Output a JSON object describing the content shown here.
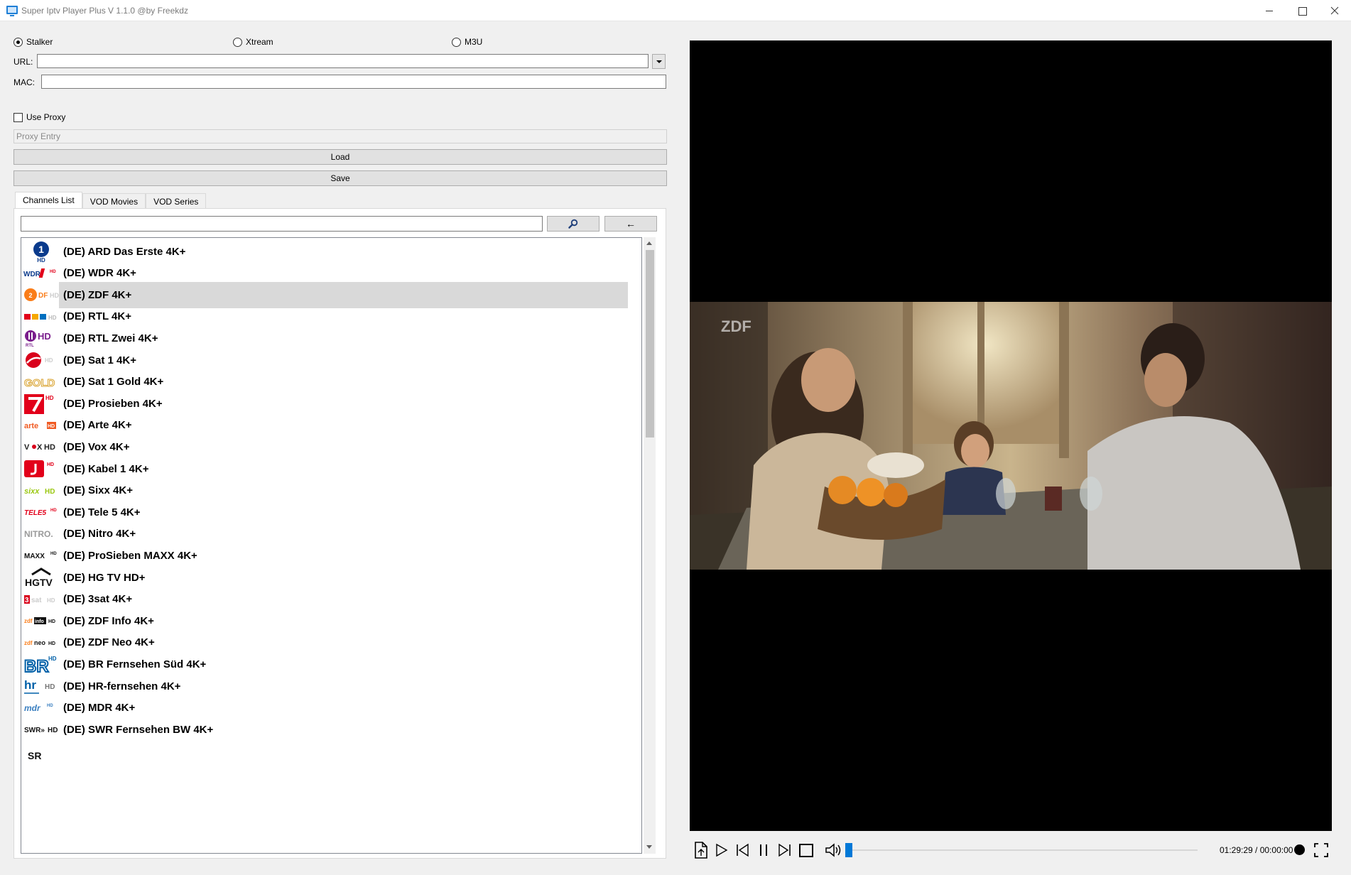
{
  "window": {
    "title": "Super Iptv Player Plus V 1.1.0 @by Freekdz"
  },
  "source_type": {
    "options": [
      "Stalker",
      "Xtream",
      "M3U"
    ],
    "selected": "Stalker"
  },
  "form": {
    "url_label": "URL:",
    "url_value": "",
    "mac_label": "MAC:",
    "mac_value": "",
    "use_proxy_label": "Use Proxy",
    "use_proxy_checked": false,
    "proxy_placeholder": "Proxy Entry",
    "load_label": "Load",
    "save_label": "Save"
  },
  "tabs": [
    {
      "label": "Channels List",
      "active": true
    },
    {
      "label": "VOD Movies",
      "active": false
    },
    {
      "label": "VOD Series",
      "active": false
    }
  ],
  "search": {
    "value": "",
    "search_icon": "magnifier-icon",
    "back_label": "←"
  },
  "channels": [
    {
      "name": "(DE) ARD Das Erste 4K+",
      "logo": "ARD 1 HD",
      "selected": false
    },
    {
      "name": "(DE) WDR 4K+",
      "logo": "WDR HD",
      "selected": false
    },
    {
      "name": "(DE) ZDF 4K+",
      "logo": "ZDF HD",
      "selected": true
    },
    {
      "name": "(DE) RTL 4K+",
      "logo": "RTL HD",
      "selected": false
    },
    {
      "name": "(DE) RTL Zwei 4K+",
      "logo": "RTL II HD",
      "selected": false
    },
    {
      "name": "(DE) Sat 1 4K+",
      "logo": "Sat.1 HD",
      "selected": false
    },
    {
      "name": "(DE) Sat 1 Gold 4K+",
      "logo": "GOLD",
      "selected": false
    },
    {
      "name": "(DE) Prosieben 4K+",
      "logo": "ProSieben HD",
      "selected": false
    },
    {
      "name": "(DE) Arte 4K+",
      "logo": "arte HD",
      "selected": false
    },
    {
      "name": "(DE) Vox 4K+",
      "logo": "VOX HD",
      "selected": false
    },
    {
      "name": "(DE) Kabel 1 4K+",
      "logo": "Kabel 1 HD",
      "selected": false
    },
    {
      "name": "(DE) Sixx 4K+",
      "logo": "sixx HD",
      "selected": false
    },
    {
      "name": "(DE) Tele 5 4K+",
      "logo": "TELE 5 HD",
      "selected": false
    },
    {
      "name": "(DE) Nitro 4K+",
      "logo": "NITRO",
      "selected": false
    },
    {
      "name": "(DE) ProSieben MAXX 4K+",
      "logo": "MAXX HD",
      "selected": false
    },
    {
      "name": "(DE) HG TV HD+",
      "logo": "HGTV",
      "selected": false
    },
    {
      "name": "(DE) 3sat 4K+",
      "logo": "3sat HD",
      "selected": false
    },
    {
      "name": "(DE) ZDF Info 4K+",
      "logo": "zdf info HD",
      "selected": false
    },
    {
      "name": "(DE) ZDF Neo 4K+",
      "logo": "zdf neo HD",
      "selected": false
    },
    {
      "name": "(DE) BR Fernsehen Süd 4K+",
      "logo": "BR HD",
      "selected": false
    },
    {
      "name": "(DE) HR-fernsehen 4K+",
      "logo": "hr HD",
      "selected": false
    },
    {
      "name": "(DE) MDR 4K+",
      "logo": "mdr HD",
      "selected": false
    },
    {
      "name": "(DE) SWR Fernsehen BW 4K+",
      "logo": "SWR HD",
      "selected": false
    }
  ],
  "player": {
    "watermark": "ZDF",
    "time_display": "01:29:29 / 00:00:00",
    "volume_level": 0,
    "progress_fraction": 0.0
  }
}
